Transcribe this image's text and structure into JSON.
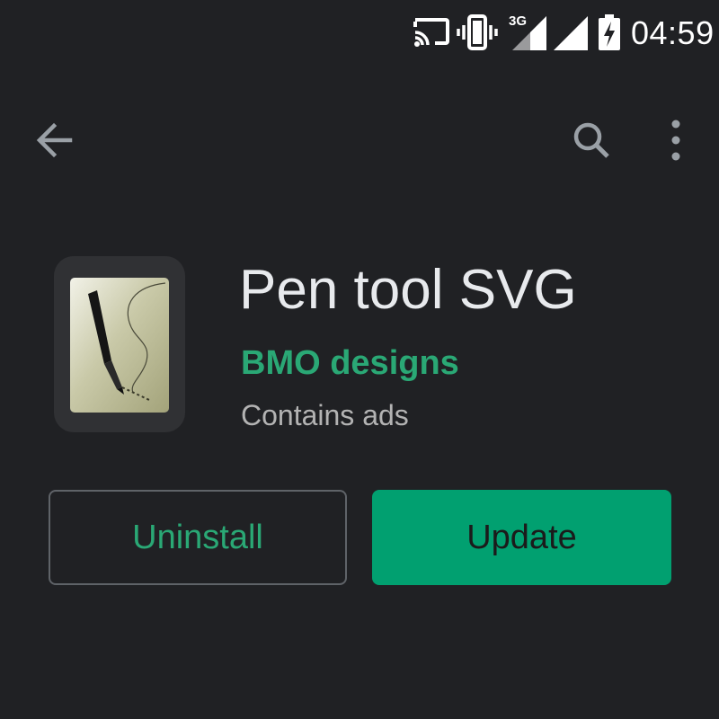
{
  "status_bar": {
    "network_type": "3G",
    "time": "04:59",
    "icons": [
      "cast-icon",
      "vibrate-icon",
      "signal-3g-icon",
      "signal-icon",
      "battery-charging-icon"
    ]
  },
  "app_bar": {
    "icons": [
      "back-arrow-icon",
      "search-icon",
      "more-vert-icon"
    ]
  },
  "app": {
    "title": "Pen tool SVG",
    "developer": "BMO designs",
    "ads_note": "Contains ads",
    "icon": "pen-nib-icon"
  },
  "actions": {
    "uninstall_label": "Uninstall",
    "update_label": "Update"
  },
  "colors": {
    "background": "#202124",
    "accent_green": "#2aa875",
    "button_green": "#01a070"
  }
}
